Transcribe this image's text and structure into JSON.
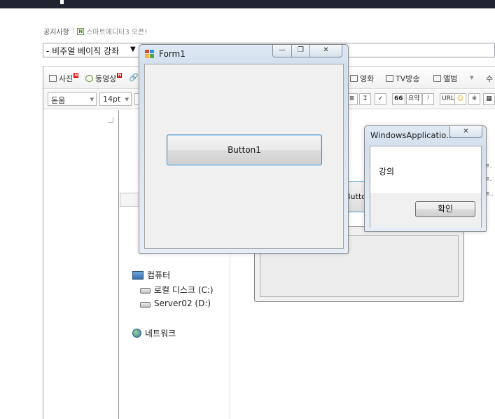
{
  "notice": {
    "label": "공지사항",
    "separator": "|",
    "badge": "N",
    "link": "스마트에디터3 오픈!"
  },
  "category": {
    "value": "- 비주얼 베이직 강좌",
    "arrow": "▼"
  },
  "editor_toolbar": {
    "photo": "사진",
    "video": "동영상",
    "movie": "영화",
    "tv": "TV방송",
    "album": "앨범",
    "more": "수"
  },
  "format_toolbar": {
    "font": "돋움",
    "size": "14pt",
    "quote": "66",
    "summary": "요약",
    "url": "URL"
  },
  "tree": {
    "computer": "컴퓨터",
    "local_disk": "로컬 디스크 (C:)",
    "server": "Server02 (D:)",
    "network": "네트워크"
  },
  "background_window": {
    "button_partial": "Butto"
  },
  "form1": {
    "title": "Form1",
    "button": "Button1"
  },
  "msgbox": {
    "title": "WindowsApplicatio...",
    "message": "강의",
    "ok": "확인"
  },
  "icons": {
    "close": "✕",
    "minimize": "—",
    "restore": "❐"
  }
}
